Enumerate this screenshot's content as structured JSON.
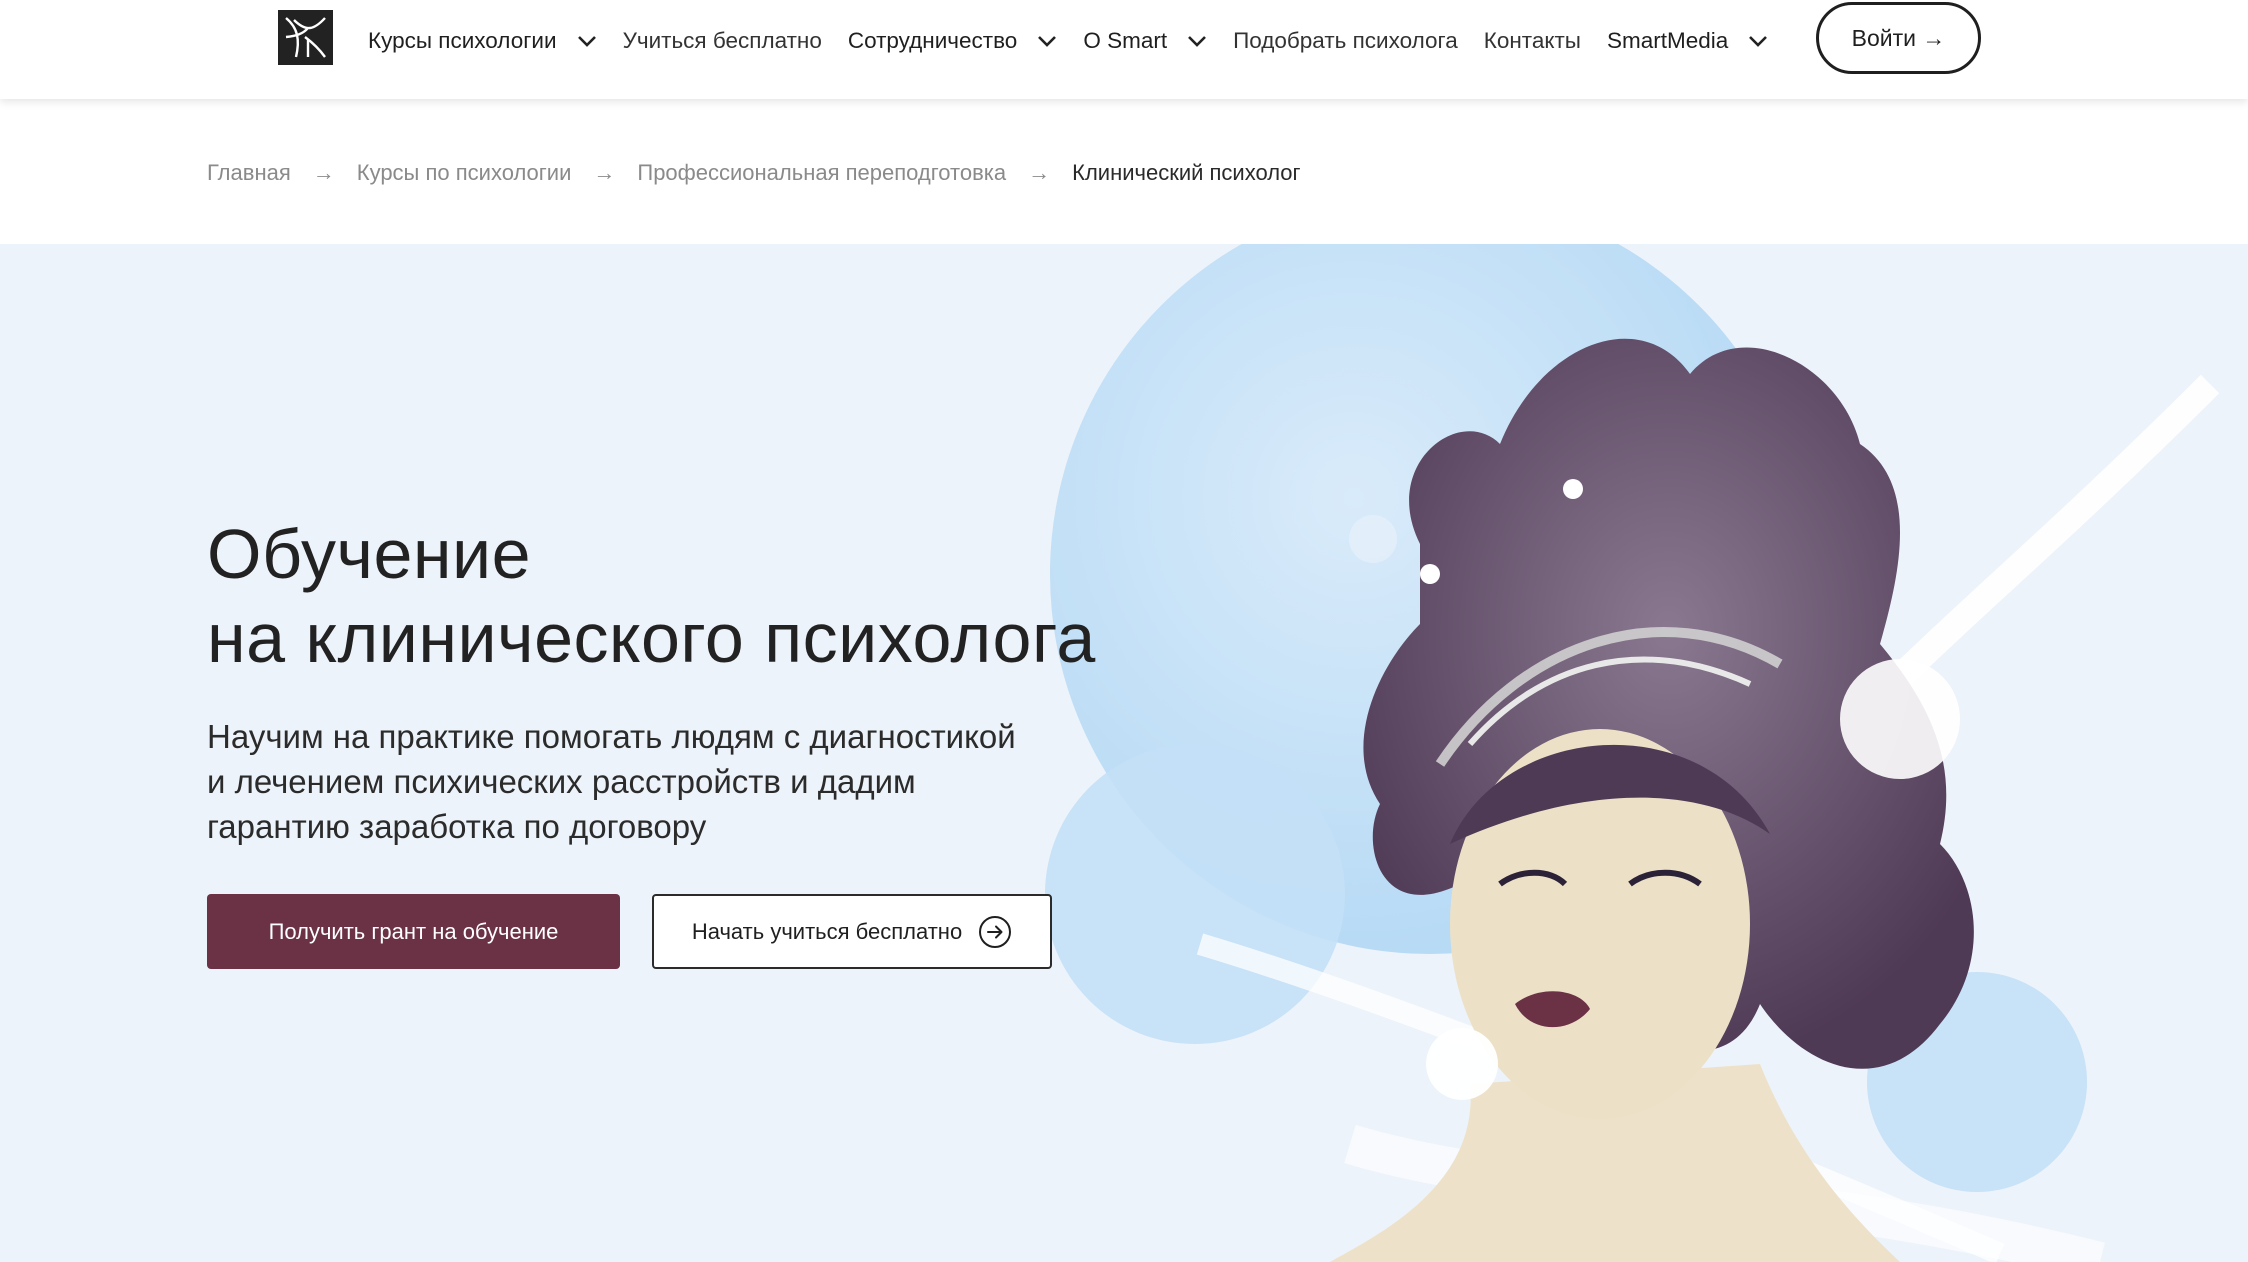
{
  "header": {
    "nav": [
      {
        "label": "Курсы психологии",
        "has_dropdown": true
      },
      {
        "label": "Учиться бесплатно",
        "has_dropdown": false
      },
      {
        "label": "Сотрудничество",
        "has_dropdown": true
      },
      {
        "label": "О Smart",
        "has_dropdown": true
      },
      {
        "label": "Подобрать психолога",
        "has_dropdown": false
      },
      {
        "label": "Контакты",
        "has_dropdown": false
      },
      {
        "label": "SmartMedia",
        "has_dropdown": true
      }
    ],
    "login_label": "Войти →"
  },
  "breadcrumb": {
    "items": [
      "Главная",
      "Курсы по психологии",
      "Профессиональная переподготовка",
      "Клинический психолог"
    ],
    "separator": "→"
  },
  "hero": {
    "title_line1": "Обучение",
    "title_line2": "на клинического психолога",
    "subtitle_line1": "Научим на практике помогать людям с диагностикой",
    "subtitle_line2": "и лечением психических расстройств и дадим",
    "subtitle_line3": "гарантию заработка по договору",
    "primary_button": "Получить грант на обучение",
    "secondary_button": "Начать учиться бесплатно"
  },
  "colors": {
    "accent": "#6b3145",
    "hero_bg": "#edf3fa",
    "text": "#1f1f1f",
    "muted": "#8a8a8a"
  },
  "icons": [
    "logo-icon",
    "chevron-down-icon",
    "arrow-right-icon",
    "circle-arrow-right-icon"
  ]
}
